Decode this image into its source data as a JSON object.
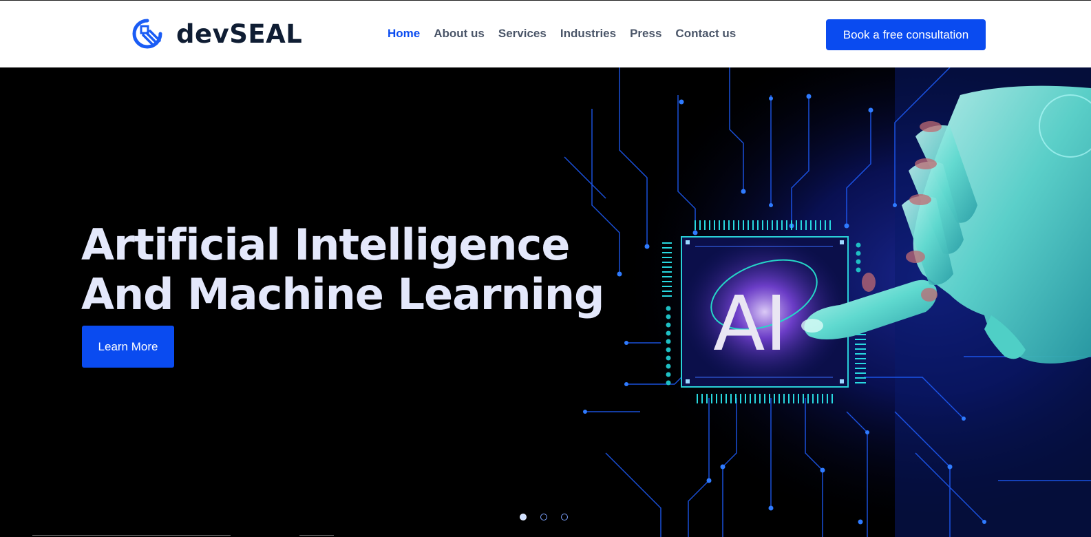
{
  "brand": {
    "name": "devSEAL"
  },
  "nav": {
    "items": [
      {
        "label": "Home",
        "active": true
      },
      {
        "label": "About us",
        "active": false
      },
      {
        "label": "Services",
        "active": false
      },
      {
        "label": "Industries",
        "active": false
      },
      {
        "label": "Press",
        "active": false
      },
      {
        "label": "Contact us",
        "active": false
      }
    ]
  },
  "header": {
    "cta_label": "Book a free consultation"
  },
  "hero": {
    "title_line1": "Artificial Intelligence",
    "title_line2": "And Machine Learning",
    "button_label": "Learn More",
    "chip_text": "AI",
    "slides": {
      "count": 3,
      "active_index": 0
    }
  },
  "colors": {
    "accent": "#0a4bf0",
    "hero_bg": "#000000",
    "hero_title": "#e4e8fb",
    "nav_text": "#4a5568",
    "circuit": "#1f5eff",
    "robot_hand": "#6fe3d8"
  },
  "icons": [
    "devseal-logo-icon",
    "ai-chip-icon",
    "robot-hand-icon"
  ]
}
